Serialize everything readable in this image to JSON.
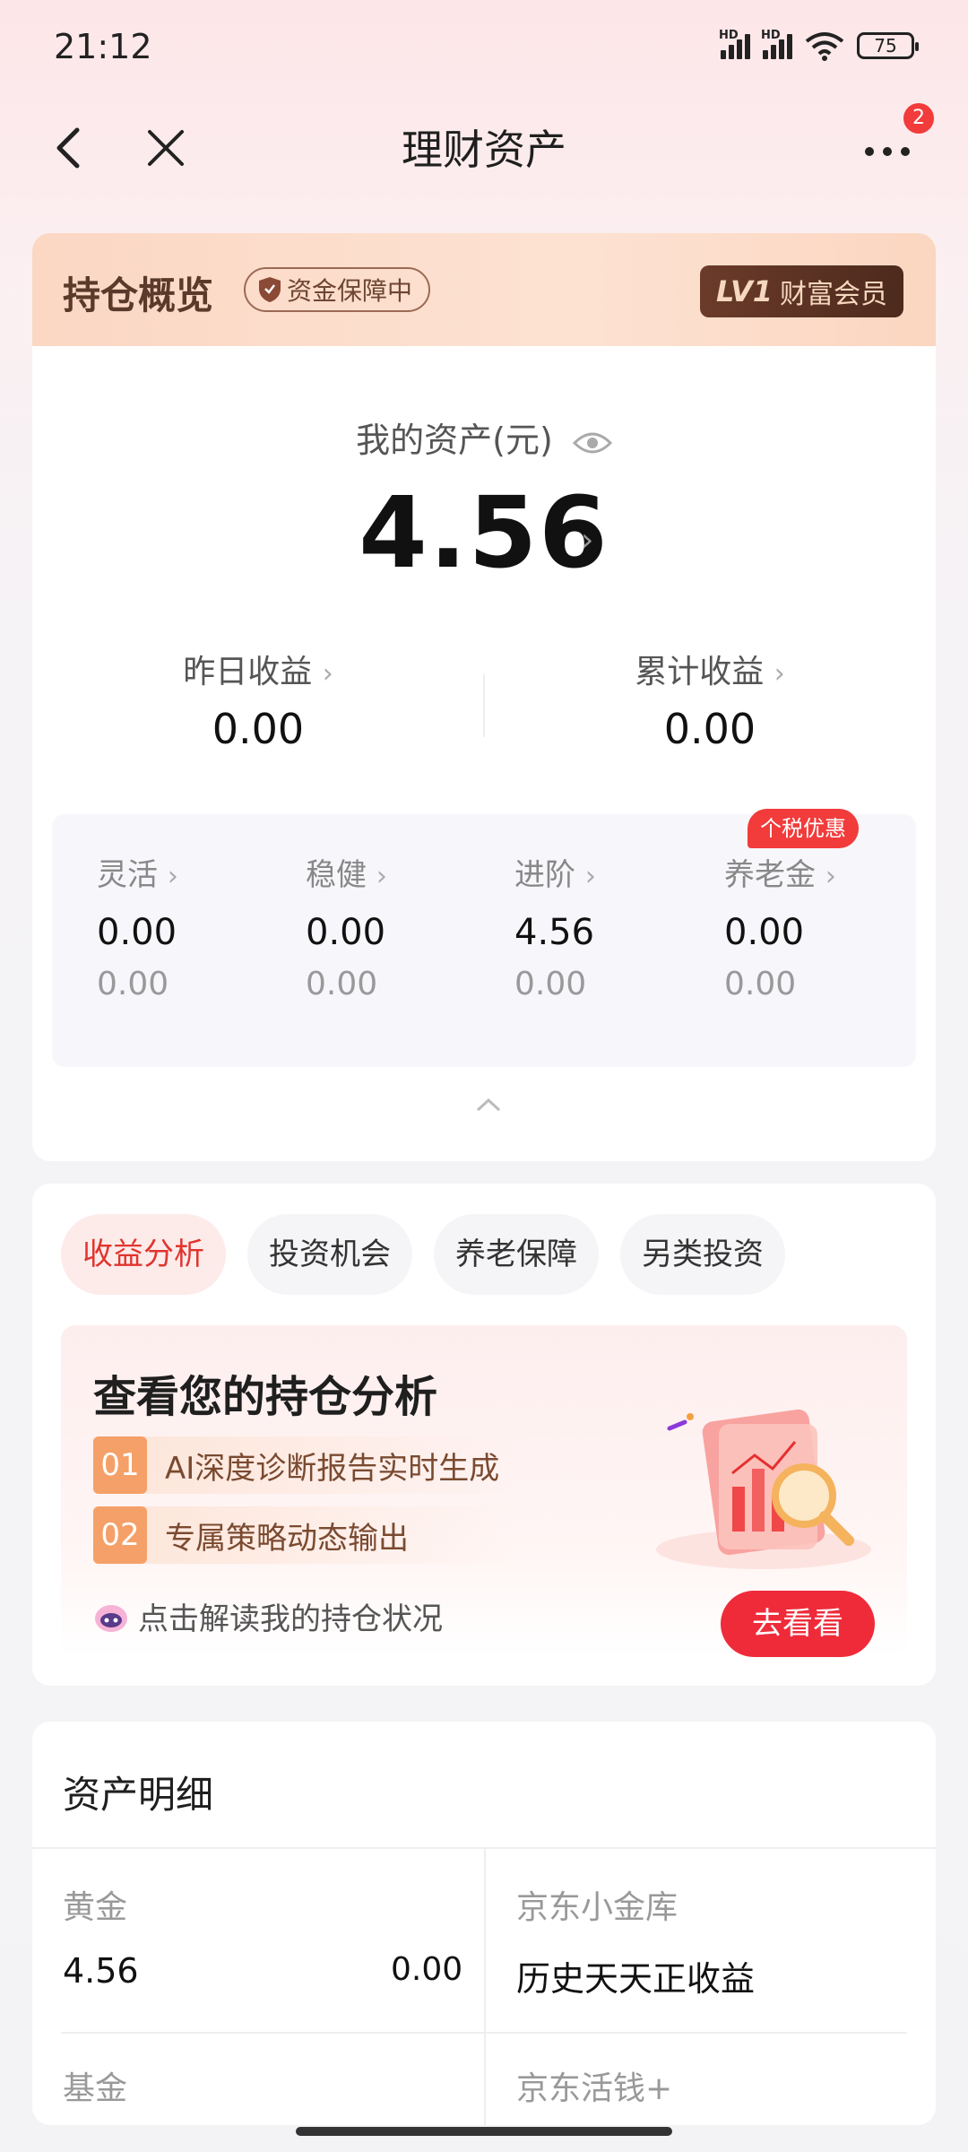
{
  "status_bar": {
    "time": "21:12",
    "battery": "75",
    "signal_badge": "HD"
  },
  "nav": {
    "title": "理财资产",
    "badge_count": "2"
  },
  "overview": {
    "title": "持仓概览",
    "guard": "资金保障中",
    "level_tag": "LV1",
    "level_text": "财富会员",
    "asset_label": "我的资产(元)",
    "asset_value": "4.56",
    "yesterday_label": "昨日收益",
    "yesterday_value": "0.00",
    "total_label": "累计收益",
    "total_value": "0.00",
    "categories": [
      {
        "label": "灵活",
        "amount": "0.00",
        "income": "0.00"
      },
      {
        "label": "稳健",
        "amount": "0.00",
        "income": "0.00"
      },
      {
        "label": "进阶",
        "amount": "4.56",
        "income": "0.00"
      },
      {
        "label": "养老金",
        "amount": "0.00",
        "income": "0.00"
      }
    ],
    "tax_badge": "个税优惠"
  },
  "analysis": {
    "tabs": [
      "收益分析",
      "投资机会",
      "养老保障",
      "另类投资"
    ],
    "active_tab": 0,
    "promo_title": "查看您的持仓分析",
    "points": [
      {
        "num": "01",
        "text": "AI深度诊断报告实时生成"
      },
      {
        "num": "02",
        "text": "专属策略动态输出"
      }
    ],
    "footer_text": "点击解读我的持仓状况",
    "button": "去看看"
  },
  "detail": {
    "title": "资产明细",
    "left": [
      {
        "label": "黄金",
        "value": "4.56",
        "sub_value": "0.00"
      },
      {
        "label": "基金"
      }
    ],
    "right": [
      {
        "label": "京东小金库",
        "value": "历史天天正收益"
      },
      {
        "label": "京东活钱+"
      }
    ]
  },
  "colors": {
    "accent_red": "#ef2b3a",
    "brown": "#5a3a2a"
  }
}
